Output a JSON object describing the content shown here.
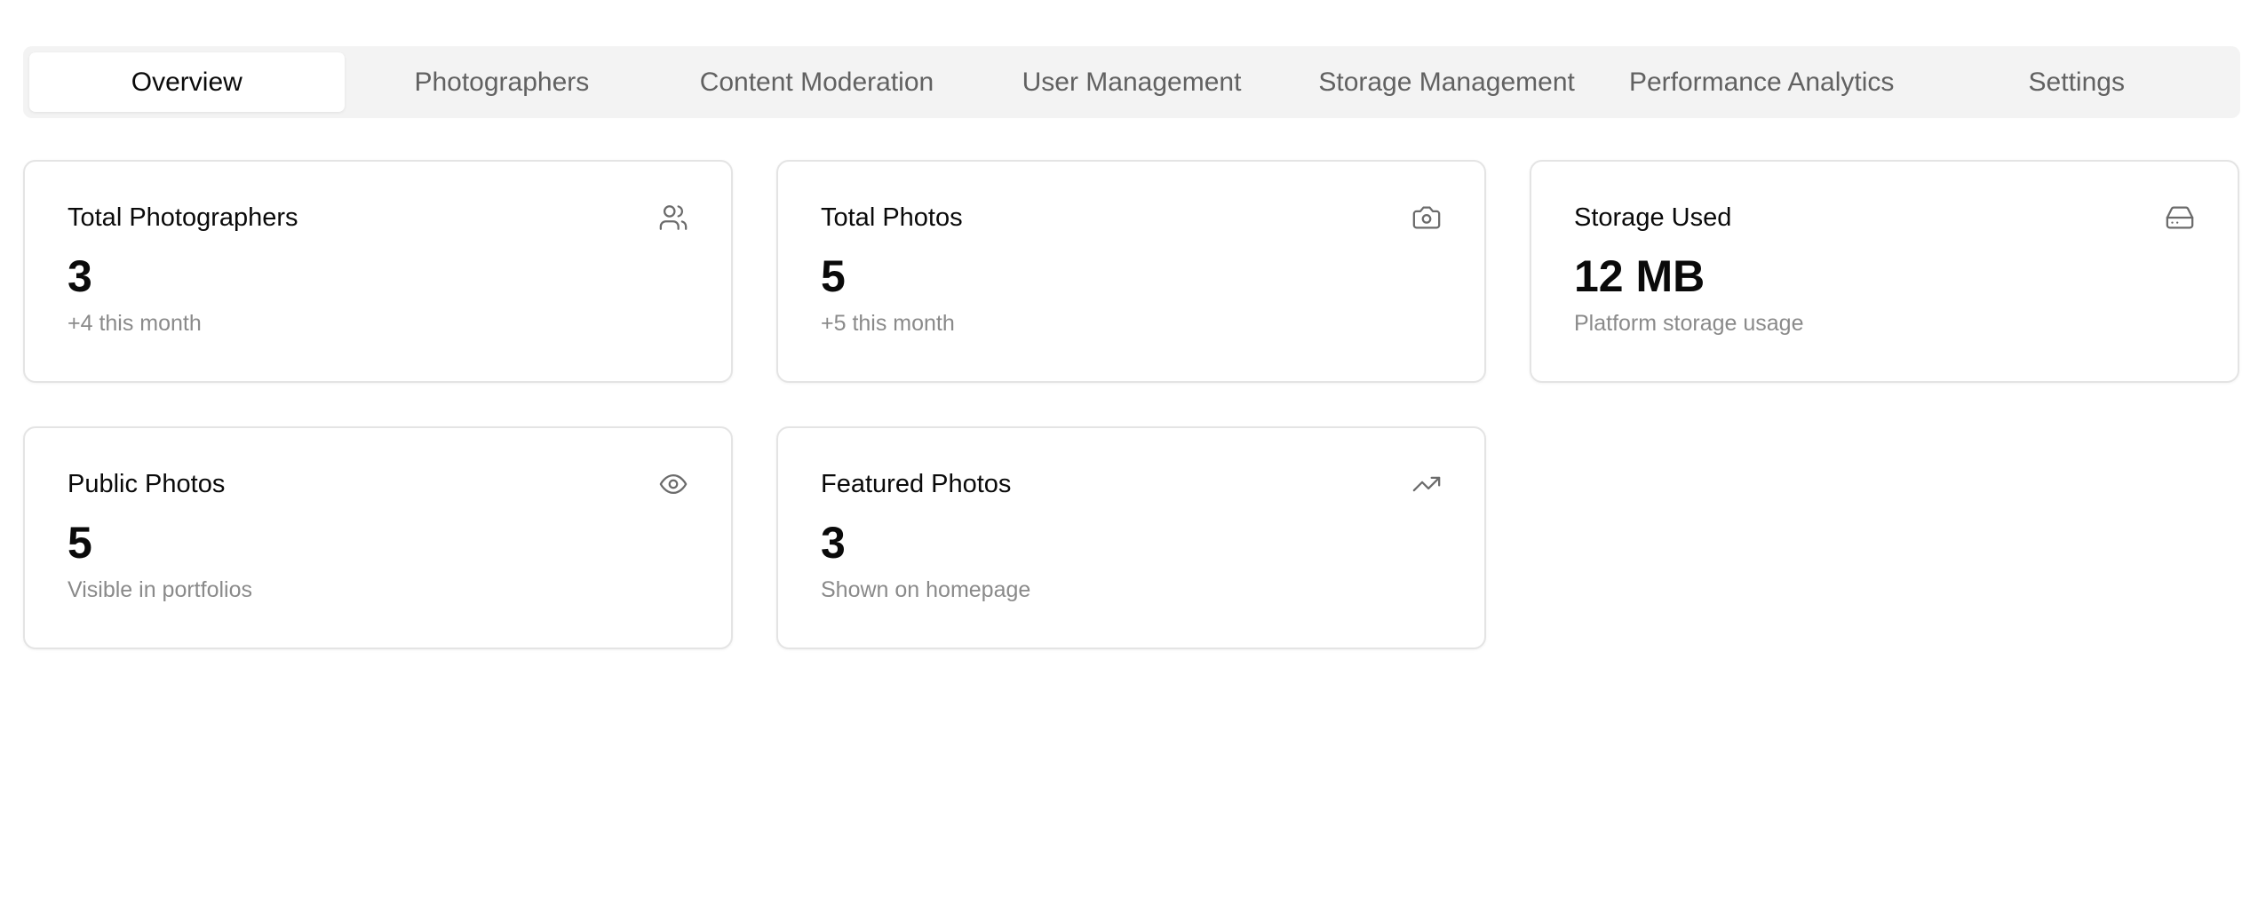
{
  "tabs": [
    {
      "label": "Overview",
      "active": true
    },
    {
      "label": "Photographers",
      "active": false
    },
    {
      "label": "Content Moderation",
      "active": false
    },
    {
      "label": "User Management",
      "active": false
    },
    {
      "label": "Storage Management",
      "active": false
    },
    {
      "label": "Performance Analytics",
      "active": false
    },
    {
      "label": "Settings",
      "active": false
    }
  ],
  "cards": [
    {
      "title": "Total Photographers",
      "value": "3",
      "subtitle": "+4 this month",
      "icon": "users-icon"
    },
    {
      "title": "Total Photos",
      "value": "5",
      "subtitle": "+5 this month",
      "icon": "camera-icon"
    },
    {
      "title": "Storage Used",
      "value": "12 MB",
      "subtitle": "Platform storage usage",
      "icon": "hard-drive-icon"
    },
    {
      "title": "Public Photos",
      "value": "5",
      "subtitle": "Visible in portfolios",
      "icon": "eye-icon"
    },
    {
      "title": "Featured Photos",
      "value": "3",
      "subtitle": "Shown on homepage",
      "icon": "trending-up-icon"
    }
  ],
  "colors": {
    "tab_bar_bg": "#f3f3f3",
    "active_tab_bg": "#ffffff",
    "muted_text": "#8a8a8a",
    "card_border": "#e4e4e4"
  }
}
